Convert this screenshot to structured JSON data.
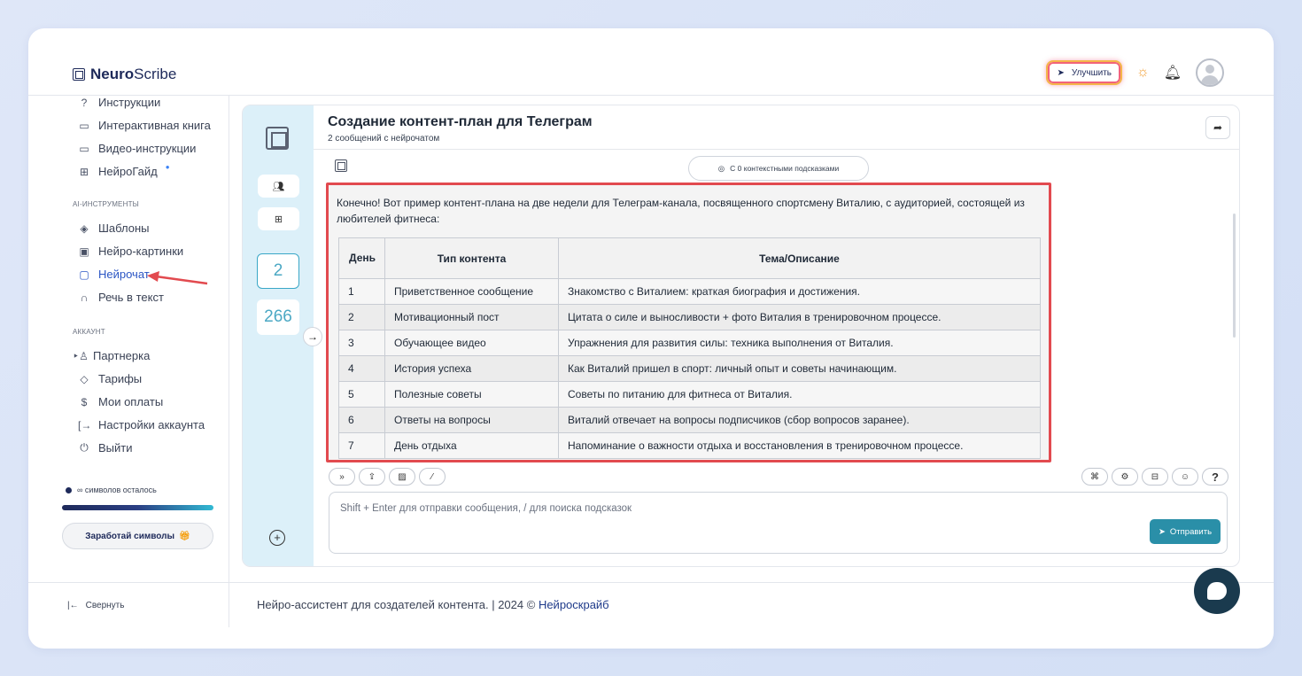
{
  "brand": {
    "name_bold": "Neuro",
    "name_rest": "Scribe"
  },
  "topbar": {
    "upgrade_label": "Улучшить"
  },
  "sidebar": {
    "items_top": [
      {
        "label": "Инструкции",
        "icon": "question-circle-icon"
      },
      {
        "label": "Интерактивная книга",
        "icon": "book-icon"
      },
      {
        "label": "Видео-инструкции",
        "icon": "video-icon"
      },
      {
        "label": "НейроГайд",
        "icon": "guide-icon"
      }
    ],
    "section_ai": "AI-ИНСТРУМЕНТЫ",
    "items_ai": [
      {
        "label": "Шаблоны",
        "icon": "layers-icon"
      },
      {
        "label": "Нейро-картинки",
        "icon": "image-icon"
      },
      {
        "label": "Нейрочат",
        "icon": "chat-icon"
      },
      {
        "label": "Речь в текст",
        "icon": "headphones-icon"
      }
    ],
    "section_account": "АККАУНТ",
    "items_account": [
      {
        "label": "Партнерка",
        "icon": "users-icon"
      },
      {
        "label": "Тарифы",
        "icon": "tag-icon"
      },
      {
        "label": "Мои оплаты",
        "icon": "dollar-icon"
      },
      {
        "label": "Настройки аккаунта",
        "icon": "login-icon"
      },
      {
        "label": "Выйти",
        "icon": "power-icon"
      }
    ],
    "symbols_left": "∞ символов осталось",
    "earn_button": "Заработай символы",
    "collapse_label": "Свернуть"
  },
  "chat": {
    "title": "Создание контент-план для Телеграм",
    "subtitle": "2 сообщений с нейрочатом",
    "rail_count_active": "2",
    "rail_count_other": "266",
    "hints_label": "С 0 контекстными подсказками",
    "intro": "Конечно! Вот пример контент-плана на две недели для Телеграм-канала, посвященного спортсмену Виталию, с аудиторией, состоящей из любителей фитнеса:",
    "table": {
      "headers": [
        "День",
        "Тип контента",
        "Тема/Описание"
      ],
      "rows": [
        [
          "1",
          "Приветственное сообщение",
          "Знакомство с Виталием: краткая биография и достижения."
        ],
        [
          "2",
          "Мотивационный пост",
          "Цитата о силе и выносливости + фото Виталия в тренировочном процессе."
        ],
        [
          "3",
          "Обучающее видео",
          "Упражнения для развития силы: техника выполнения от Виталия."
        ],
        [
          "4",
          "История успеха",
          "Как Виталий пришел в спорт: личный опыт и советы начинающим."
        ],
        [
          "5",
          "Полезные советы",
          "Советы по питанию для фитнеса от Виталия."
        ],
        [
          "6",
          "Ответы на вопросы",
          "Виталий отвечает на вопросы подписчиков (сбор вопросов заранее)."
        ],
        [
          "7",
          "День отдыха",
          "Напоминание о важности отдыха и восстановления в тренировочном процессе."
        ]
      ]
    },
    "input_placeholder": "Shift + Enter для отправки сообщения, / для поиска подсказок",
    "send_label": "Отправить"
  },
  "footer": {
    "text": "Нейро-ассистент для создателей контента.  | 2024 © ",
    "link": "Нейроскрайб"
  },
  "colors": {
    "accent": "#2a8fa8",
    "highlight": "#e24a4f",
    "rail": "#dcf0f9"
  }
}
